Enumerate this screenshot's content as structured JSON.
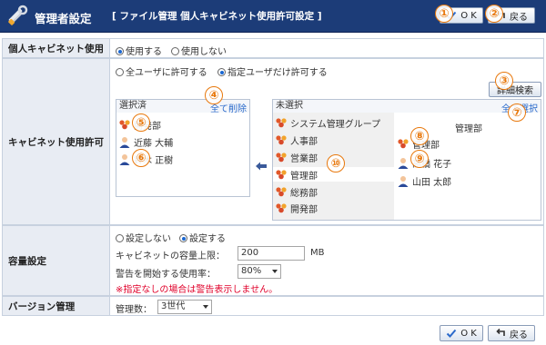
{
  "header": {
    "title": "管理者設定",
    "subtitle": "[ ファイル管理  個人キャビネット使用許可設定 ]",
    "ok_label": "O K",
    "back_label": "戻る"
  },
  "callouts": [
    "①",
    "②",
    "③",
    "④",
    "⑤",
    "⑥",
    "⑦",
    "⑧",
    "⑨",
    "⑩"
  ],
  "personal_cabinet": {
    "label": "個人キャビネット使用",
    "opt_use": "使用する",
    "opt_nouse": "使用しない"
  },
  "permission": {
    "label": "キャビネット使用許可",
    "opt_all": "全ユーザに許可する",
    "opt_specified": "指定ユーザだけ許可する",
    "search_button": "詳細検索",
    "selected": {
      "title": "選択済",
      "remove_all": "全て削除",
      "items": [
        {
          "type": "group",
          "name": "開発部"
        },
        {
          "type": "user",
          "name": "近藤 大輔"
        },
        {
          "type": "user",
          "name": "鈴木 正樹"
        }
      ]
    },
    "unselected": {
      "title": "未選択",
      "select_all": "全て選択",
      "groups": [
        "システム管理グループ",
        "人事部",
        "営業部",
        "管理部",
        "総務部",
        "開発部"
      ],
      "right_header": "管理部",
      "members": [
        {
          "type": "group",
          "name": "管理部"
        },
        {
          "type": "user",
          "name": "高橋 花子"
        },
        {
          "type": "user",
          "name": "山田 太郎"
        }
      ]
    }
  },
  "capacity": {
    "label": "容量設定",
    "opt_none": "設定しない",
    "opt_set": "設定する",
    "limit_label": "キャビネットの容量上限：",
    "limit_value": "200",
    "limit_unit": "MB",
    "warn_label": "警告を開始する使用率：",
    "warn_value": "80%",
    "note": "※指定なしの場合は警告表示しません。"
  },
  "version": {
    "label": "バージョン管理",
    "count_label": "管理数：",
    "count_value": "3世代"
  },
  "footer": {
    "ok_label": "O K",
    "back_label": "戻る"
  }
}
